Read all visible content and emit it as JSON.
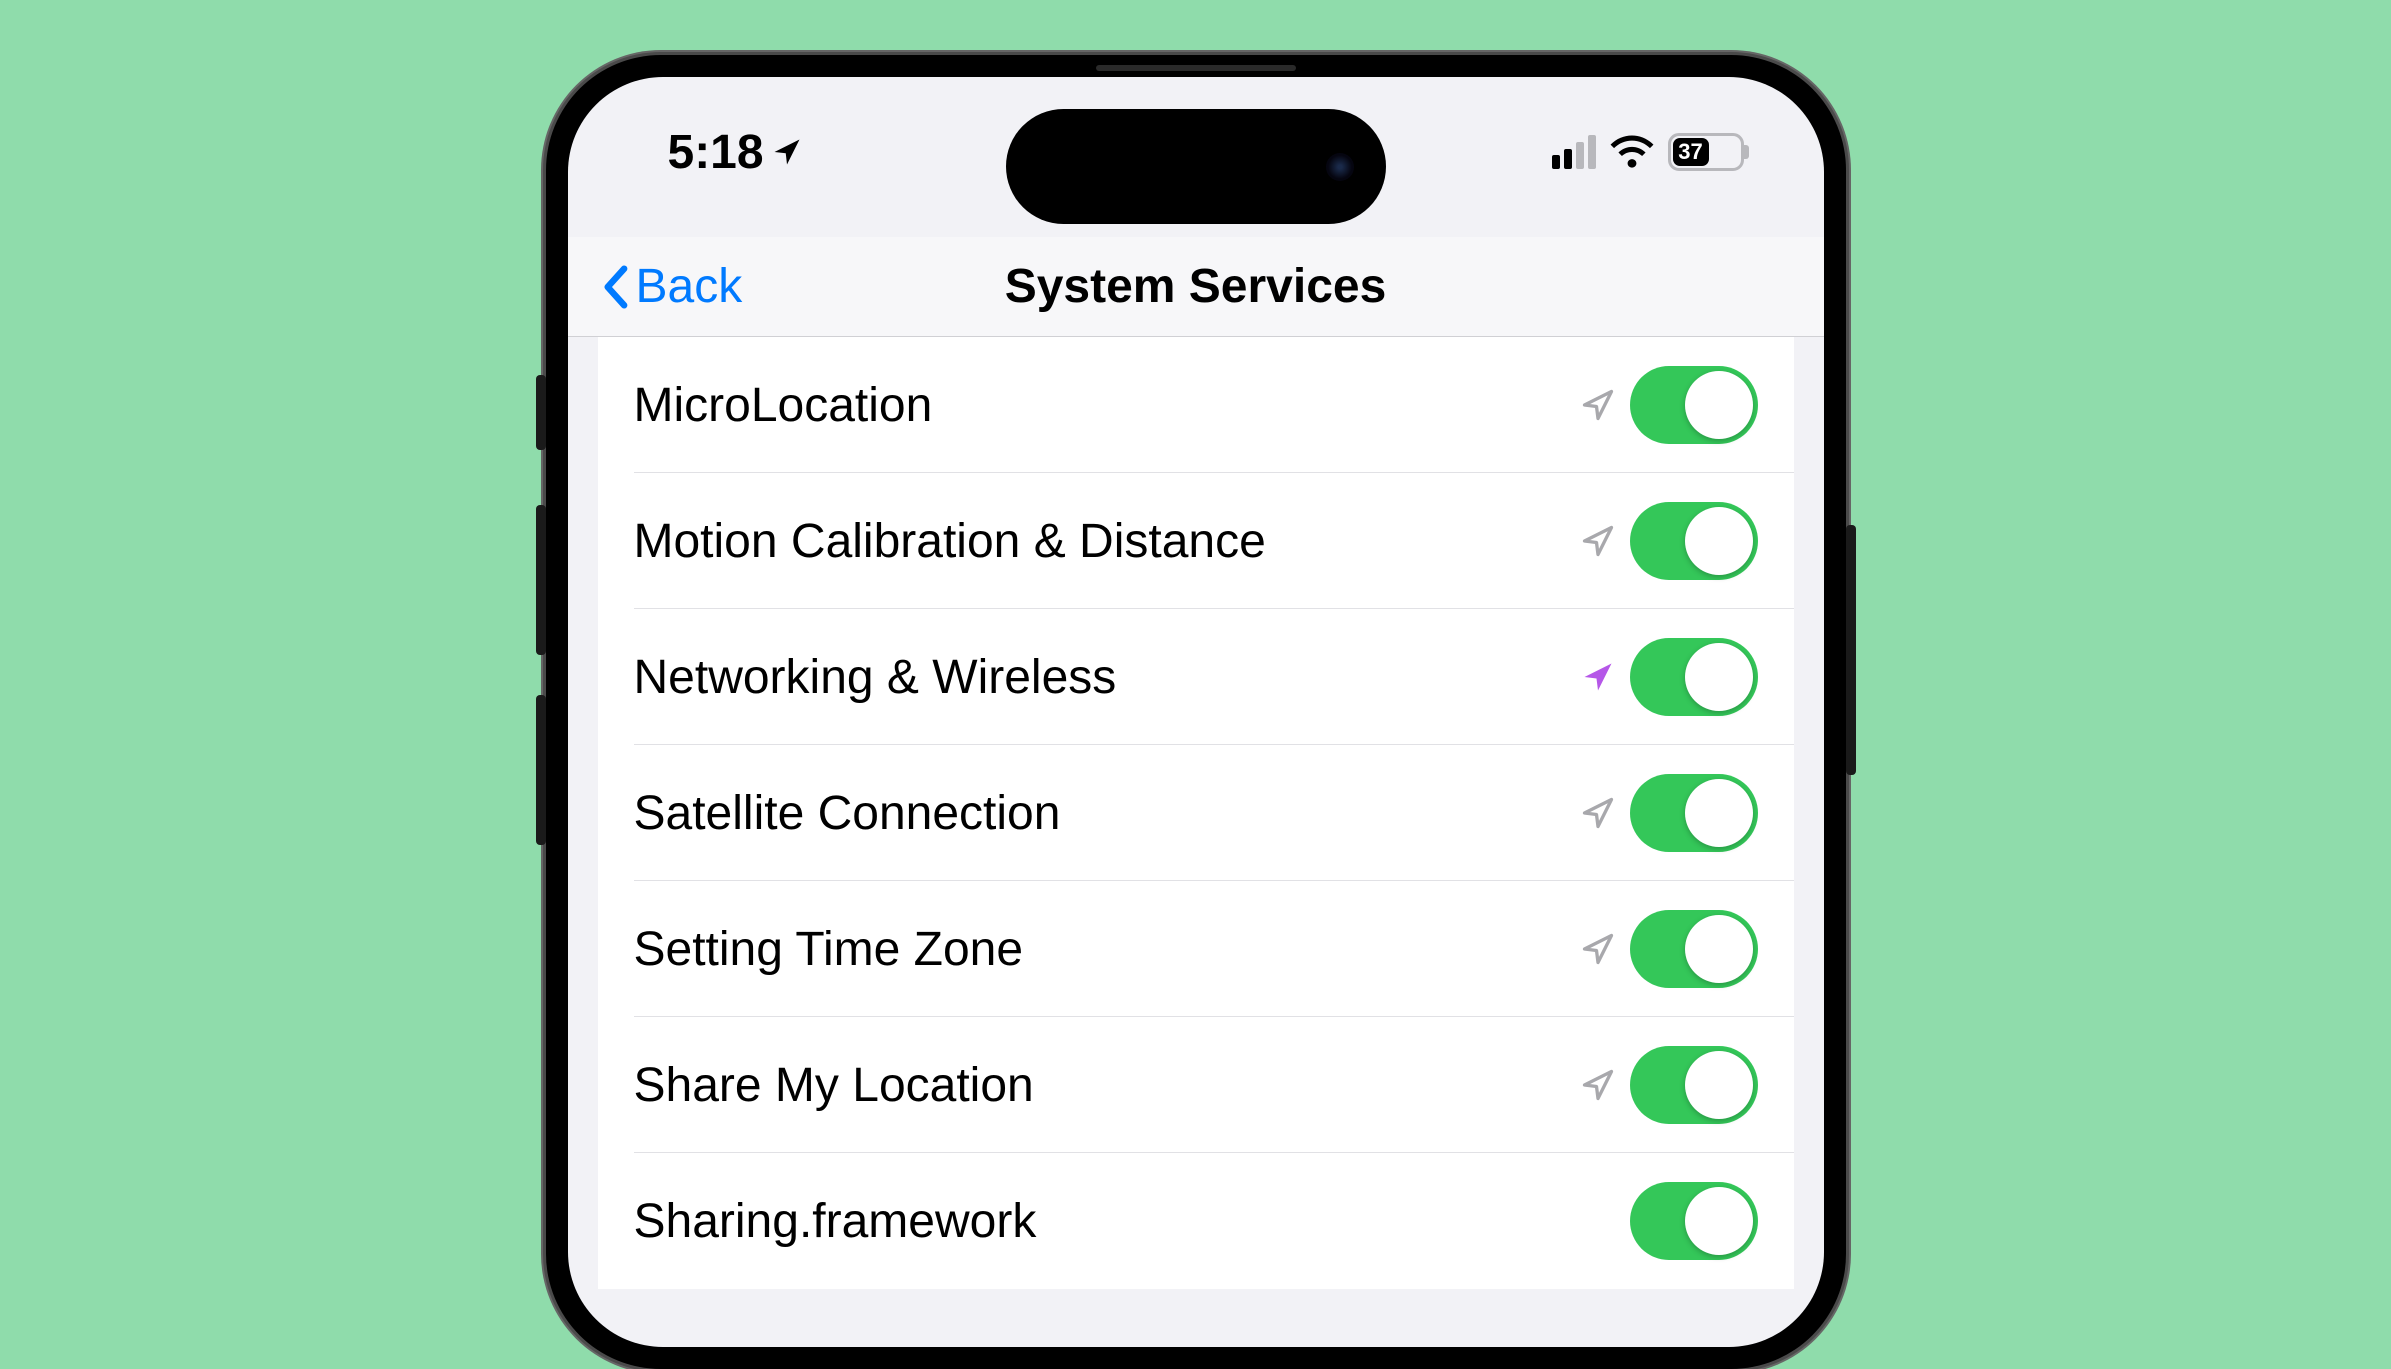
{
  "status": {
    "time": "5:18",
    "battery_pct": "37"
  },
  "nav": {
    "back_label": "Back",
    "title": "System Services"
  },
  "rows": [
    {
      "label": "MicroLocation",
      "arrow": "gray",
      "on": true
    },
    {
      "label": "Motion Calibration & Distance",
      "arrow": "gray",
      "on": true
    },
    {
      "label": "Networking & Wireless",
      "arrow": "purple",
      "on": true
    },
    {
      "label": "Satellite Connection",
      "arrow": "gray",
      "on": true
    },
    {
      "label": "Setting Time Zone",
      "arrow": "gray",
      "on": true
    },
    {
      "label": "Share My Location",
      "arrow": "gray",
      "on": true
    },
    {
      "label": "Sharing.framework",
      "arrow": "none",
      "on": true
    }
  ],
  "colors": {
    "gray_arrow": "#a8a8ac",
    "purple_arrow": "#b557e8"
  }
}
